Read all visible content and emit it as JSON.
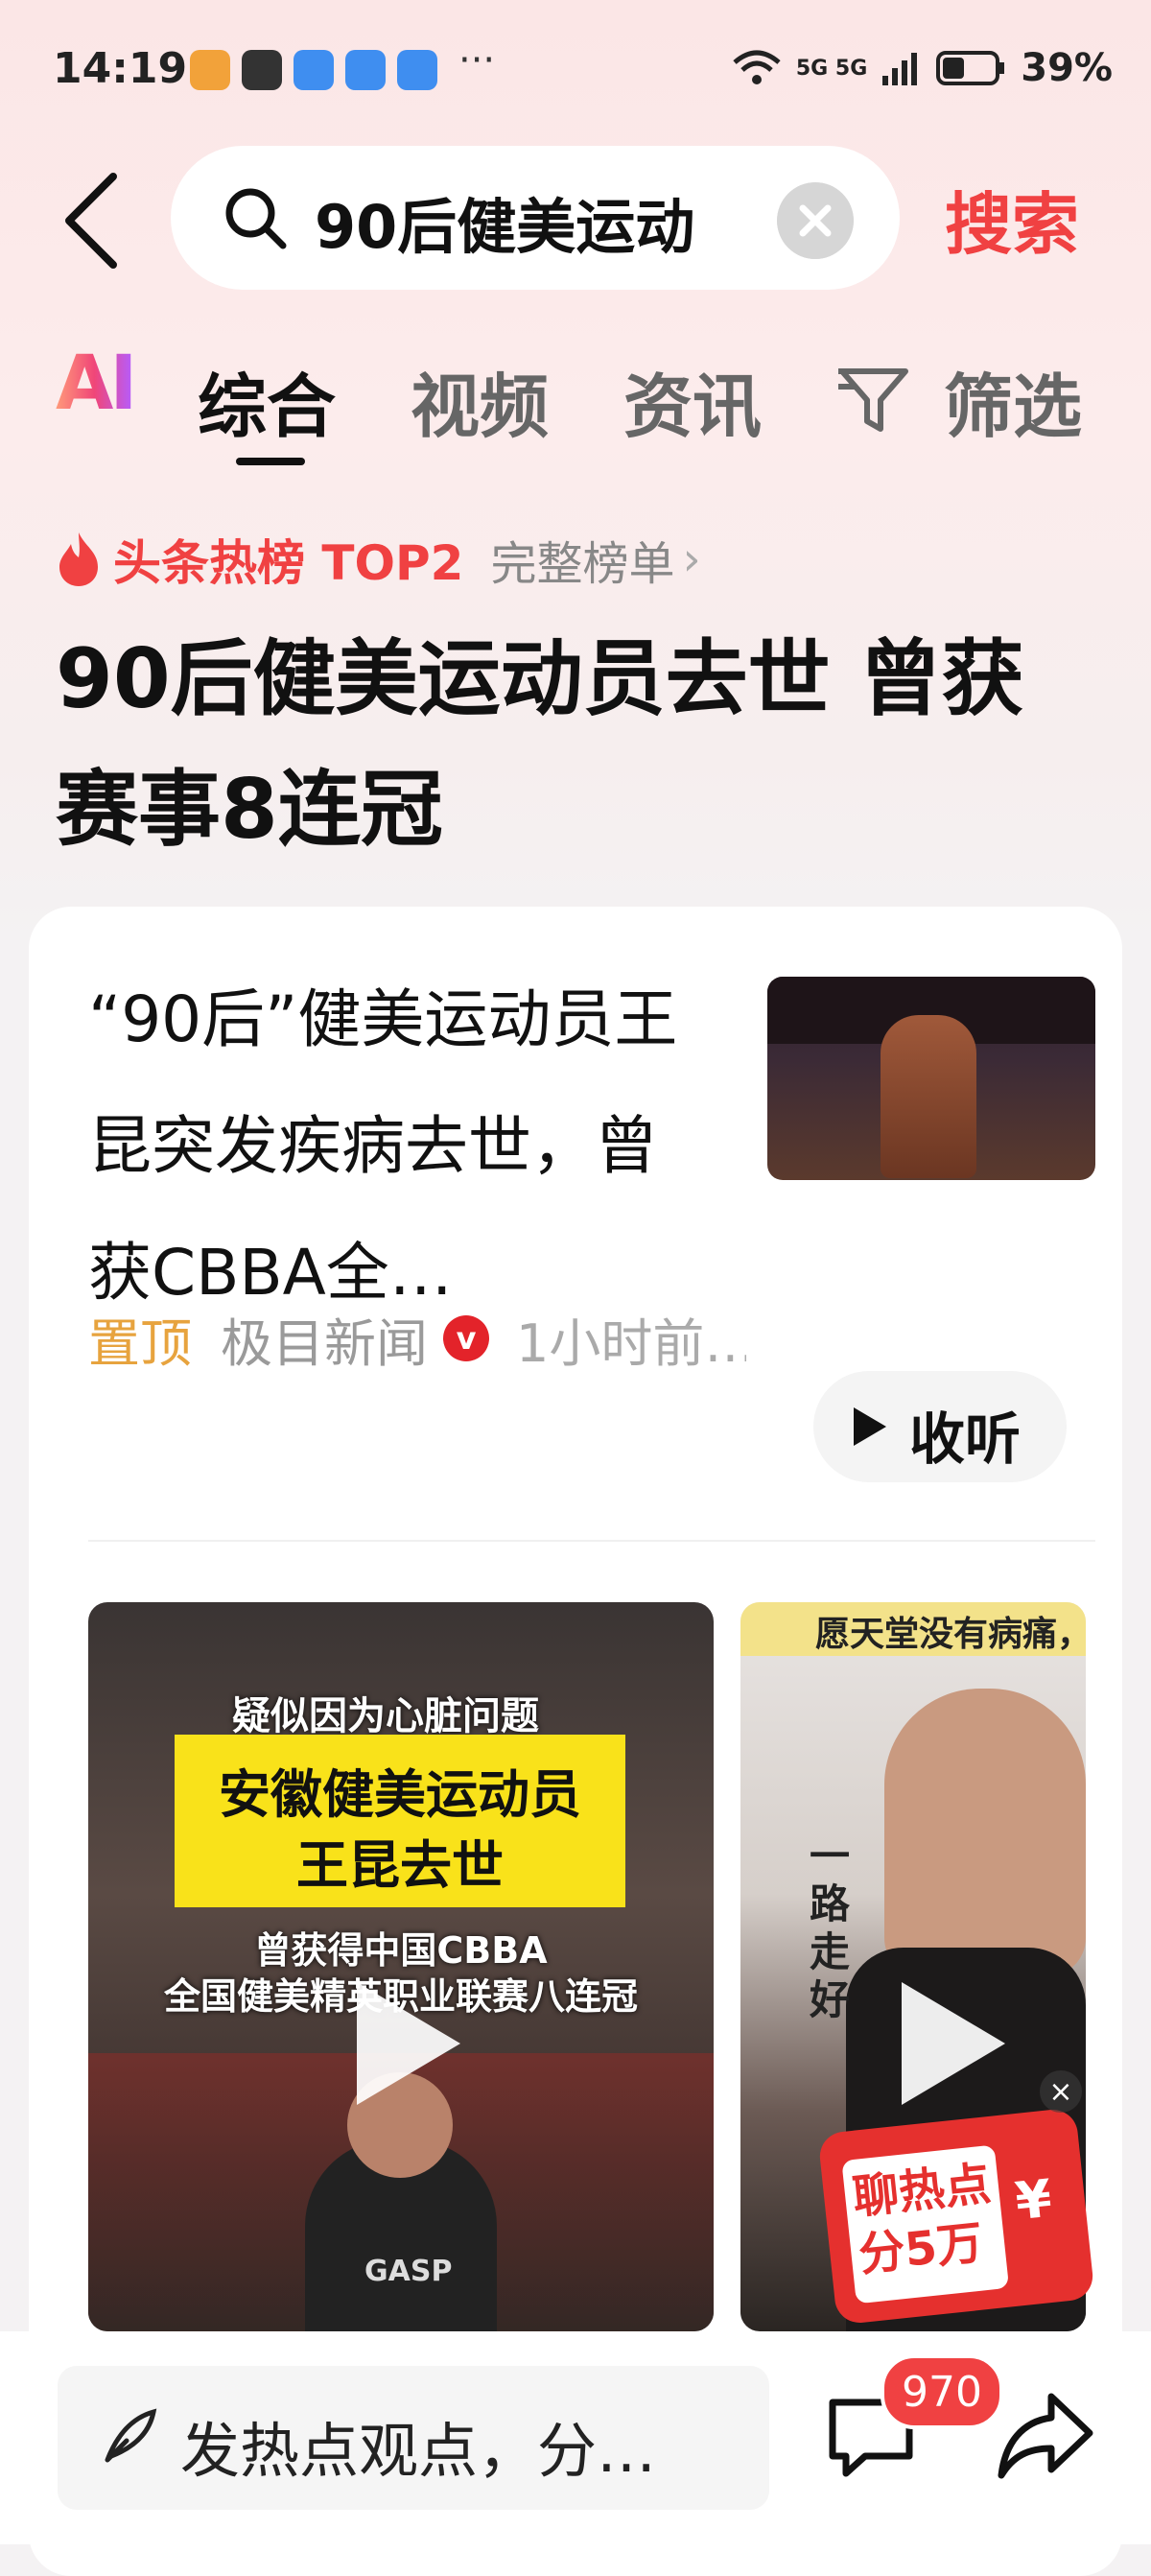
{
  "status_bar": {
    "time": "14:19",
    "network": "5G 5G",
    "battery": "39%"
  },
  "search": {
    "query": "90后健美运动",
    "button_label": "搜索"
  },
  "tabs": {
    "ai": "AI",
    "items": [
      "综合",
      "视频",
      "资讯",
      "筛选"
    ],
    "active": "综合"
  },
  "hot": {
    "label": "头条热榜 TOP2",
    "more": "完整榜单"
  },
  "headline": "90后健美运动员去世 曾获赛事8连冠",
  "article": {
    "title": "“90后”健美运动员王昆突发疾病去世，曾获CBBA全…",
    "pin": "置顶",
    "source": "极目新闻",
    "verified": "v",
    "time": "1小时前…",
    "listen_label": "收听"
  },
  "video1": {
    "caption_top": "疑似因为心脏问题",
    "title_line1": "安徽健美运动员",
    "title_line2": "王昆去世",
    "caption_line1": "曾获得中国CBBA",
    "caption_line2": "全国健美精英职业联赛八连冠",
    "shirt": "GASP"
  },
  "video2": {
    "top_text": "愿天堂没有病痛，",
    "vertical_text": "一路走好"
  },
  "promo": {
    "text_line1": "聊热点",
    "text_line2": "分5万",
    "yen": "¥",
    "close": "×"
  },
  "bottom": {
    "comment_placeholder": "发热点观点，分…",
    "comment_count": "970"
  }
}
